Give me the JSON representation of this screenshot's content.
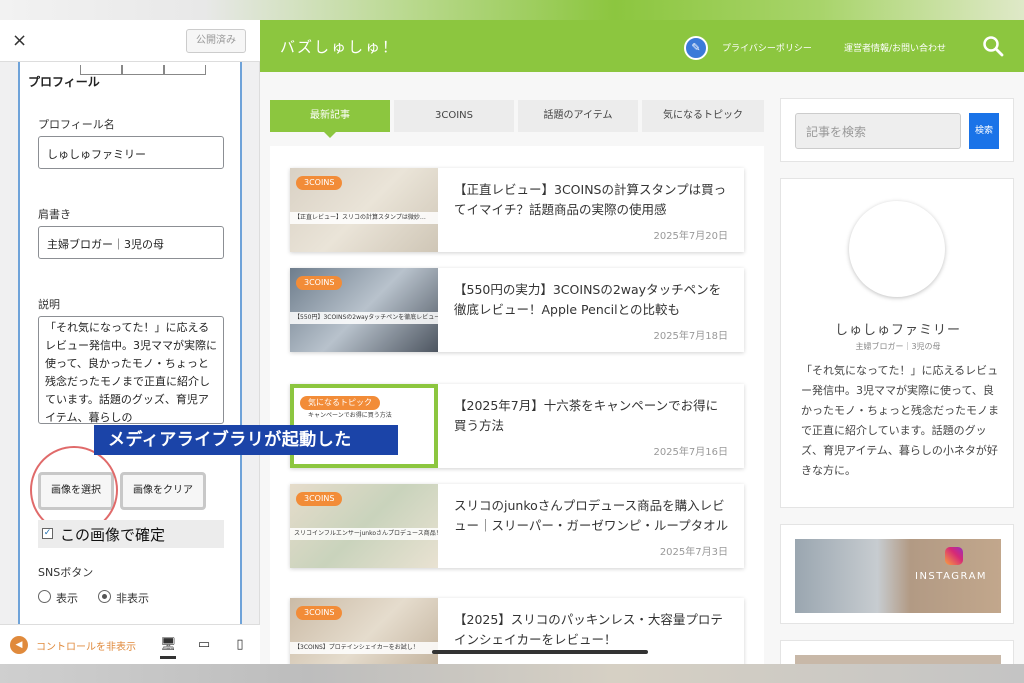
{
  "customizer": {
    "close_glyph": "×",
    "published_label": "公開済み",
    "section_title": "プロフィール",
    "profile_name": {
      "label": "プロフィール名",
      "value": "しゅしゅファミリー"
    },
    "tagline": {
      "label": "肩書き",
      "value": "主婦ブロガー｜3児の母"
    },
    "description": {
      "label": "説明",
      "value": "「それ気になってた！」に応えるレビュー発信中。3児ママが実際に使って、良かったモノ・ちょっと残念だったモノまで正直に紹介しています。話題のグッズ、育児アイテム、暮らしの"
    },
    "select_image_label": "画像を選択",
    "clear_image_label": "画像をクリア",
    "confirm_label": "この画像で確定",
    "sns": {
      "label": "SNSボタン",
      "show_label": "表示",
      "hide_label": "非表示",
      "selected": "非表示"
    },
    "hide_controls_label": "コントロールを非表示"
  },
  "caption": "メディアライブラリが起動した",
  "site": {
    "title": "バズしゅしゅ！",
    "nav": [
      "プライバシーポリシー",
      "運営者情報/お問い合わせ"
    ],
    "tabs": [
      "最新記事",
      "3COINS",
      "話題のアイテム",
      "気になるトピック"
    ],
    "active_tab": "最新記事",
    "posts": [
      {
        "badge": "3COINS",
        "thumb_caption": "【正直レビュー】スリコの計算スタンプは微妙…",
        "title": "【正直レビュー】3COINSの計算スタンプは買ってイマイチ？話題商品の実際の使用感",
        "date": "2025年7月20日"
      },
      {
        "badge": "3COINS",
        "thumb_caption": "【550円】3COINSの2wayタッチペンを徹底レビュー！",
        "title": "【550円の実力】3COINSの2wayタッチペンを徹底レビュー！Apple Pencilとの比較も",
        "date": "2025年7月18日"
      },
      {
        "badge": "気になるトピック",
        "thumb_caption": "キャンペーンでお得に買う方法",
        "title": "【2025年7月】十六茶をキャンペーンでお得に買う方法",
        "date": "2025年7月16日"
      },
      {
        "badge": "3COINS",
        "thumb_caption": "スリコインフルエンサーjunkoさんプロデュース商品！",
        "title": "スリコのjunkoさんプロデュース商品を購入レビュー｜スリーパー・ガーゼワンピ・ループタオル",
        "date": "2025年7月3日"
      },
      {
        "badge": "3COINS",
        "thumb_caption": "【3COINS】プロテインシェイカーをお試し！",
        "title": "【2025】スリコのパッキンレス・大容量プロテインシェイカーをレビュー！",
        "date": ""
      }
    ],
    "sidebar": {
      "search_placeholder": "記事を検索",
      "search_button": "検索",
      "profile_name": "しゅしゅファミリー",
      "profile_role": "主婦ブロガー｜3児の母",
      "profile_bio": "「それ気になってた！」に応えるレビュー発信中。3児ママが実際に使って、良かったモノ・ちょっと残念だったモノまで正直に紹介しています。話題のグッズ、育児アイテム、暮らしの小ネタが好きな方に。",
      "instagram_text": "INSTAGRAM"
    }
  },
  "colors": {
    "brand_green": "#8cc63f",
    "accent_blue": "#1a73e8",
    "badge_orange": "#f28c38",
    "caption_bg": "#1b44a8"
  }
}
